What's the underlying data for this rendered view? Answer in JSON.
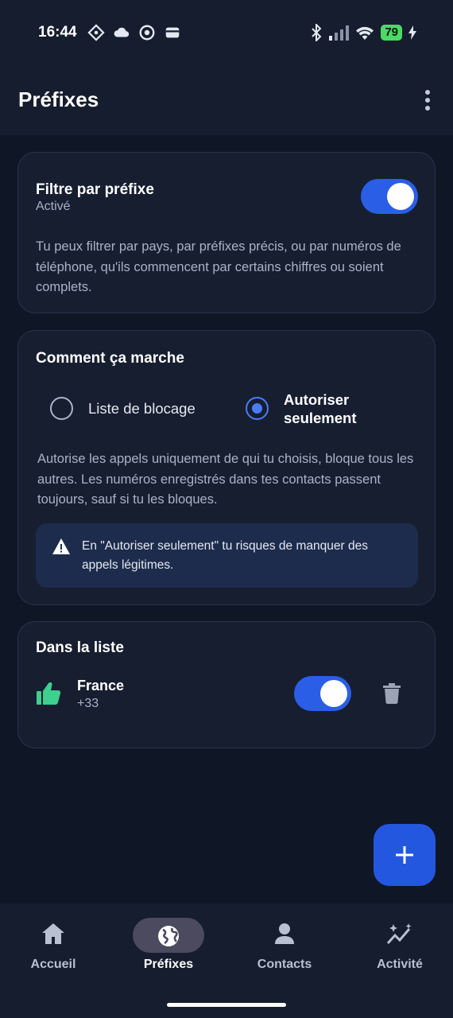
{
  "status_bar": {
    "time": "16:44",
    "battery": "79",
    "left_icons": [
      "settings-diamond-icon",
      "cloud-icon",
      "sync-icon",
      "wallet-icon"
    ],
    "right_icons": [
      "bluetooth-icon",
      "signal-icon",
      "wifi-icon",
      "charging-icon"
    ]
  },
  "header": {
    "title": "Préfixes",
    "menu_icon": "more-vert-icon"
  },
  "filter_card": {
    "title": "Filtre par préfixe",
    "status": "Activé",
    "enabled": true,
    "description": "Tu peux filtrer par pays, par préfixes précis, ou par numéros de téléphone, qu'ils commencent par certains chiffres ou soient complets."
  },
  "how_card": {
    "title": "Comment ça marche",
    "options": [
      {
        "label": "Liste de blocage",
        "selected": false
      },
      {
        "label": "Autoriser seulement",
        "selected": true
      }
    ],
    "description": "Autorise les appels uniquement de qui tu choisis, bloque tous les autres. Les numéros enregistrés dans tes contacts passent toujours, sauf si tu les bloques.",
    "warning": "En \"Autoriser seulement\" tu risques de manquer des appels légitimes."
  },
  "list_card": {
    "title": "Dans la liste",
    "items": [
      {
        "name": "France",
        "code": "+33",
        "enabled": true,
        "icon": "thumb-up-icon"
      }
    ]
  },
  "fab": {
    "icon": "plus-icon"
  },
  "bottom_nav": {
    "items": [
      {
        "label": "Accueil",
        "icon": "home-icon",
        "active": false
      },
      {
        "label": "Préfixes",
        "icon": "globe-icon",
        "active": true
      },
      {
        "label": "Contacts",
        "icon": "person-icon",
        "active": false
      },
      {
        "label": "Activité",
        "icon": "activity-icon",
        "active": false
      }
    ]
  },
  "colors": {
    "background": "#0f1626",
    "card": "#161e30",
    "accent": "#2a5ee6",
    "success": "#3fcf8e",
    "warning_bg": "#1d2c4c"
  }
}
